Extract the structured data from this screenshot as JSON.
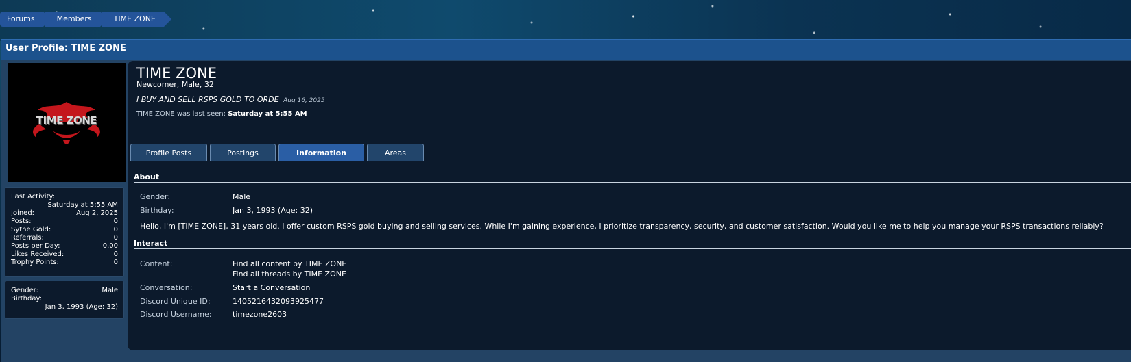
{
  "breadcrumb": [
    "Forums",
    "Members",
    "TIME ZONE"
  ],
  "page_title": "User Profile: TIME ZONE",
  "avatar": {
    "text": "TIME ZONE"
  },
  "stats": [
    {
      "label": "Last Activity:",
      "value": "Saturday at 5:55 AM"
    },
    {
      "label": "Joined:",
      "value": "Aug 2, 2025"
    },
    {
      "label": "Posts:",
      "value": "0"
    },
    {
      "label": "Sythe Gold:",
      "value": "0"
    },
    {
      "label": "Referrals:",
      "value": "0"
    },
    {
      "label": "Posts per Day:",
      "value": "0.00"
    },
    {
      "label": "Likes Received:",
      "value": "0"
    },
    {
      "label": "Trophy Points:",
      "value": "0"
    }
  ],
  "sidebar_info": [
    {
      "label": "Gender:",
      "value": "Male"
    },
    {
      "label": "Birthday:",
      "value": "Jan 3, 1993 (Age: 32)"
    }
  ],
  "profile": {
    "username": "TIME ZONE",
    "user_title": "Newcomer, Male, 32",
    "status_text": "I BUY AND SELL RSPS GOLD TO ORDE",
    "status_date": "Aug 16, 2025",
    "last_seen_prefix": "TIME ZONE was last seen:",
    "last_seen_value": "Saturday at 5:55 AM"
  },
  "tabs": [
    {
      "label": "Profile Posts",
      "active": false
    },
    {
      "label": "Postings",
      "active": false
    },
    {
      "label": "Information",
      "active": true
    },
    {
      "label": "Areas",
      "active": false
    }
  ],
  "about": {
    "heading": "About",
    "gender_label": "Gender:",
    "gender_value": "Male",
    "birthday_label": "Birthday:",
    "birthday_value": "Jan 3, 1993 (Age: 32)",
    "bio": "Hello, I'm [TIME ZONE], 31 years old. I offer custom RSPS gold buying and selling services. While I'm gaining experience, I prioritize transparency, security, and customer satisfaction. Would you like me to help you manage your RSPS transactions reliably?"
  },
  "interact": {
    "heading": "Interact",
    "content_label": "Content:",
    "content_links": [
      "Find all content by TIME ZONE",
      "Find all threads by TIME ZONE"
    ],
    "conversation_label": "Conversation:",
    "conversation_link": "Start a Conversation",
    "discord_id_label": "Discord Unique ID:",
    "discord_id_value": "1405216432093925477",
    "discord_username_label": "Discord Username:",
    "discord_username_value": "timezone2603"
  },
  "colors": {
    "accent": "#24549a",
    "panel": "#0c1a2c",
    "logo_red": "#c4161c"
  }
}
